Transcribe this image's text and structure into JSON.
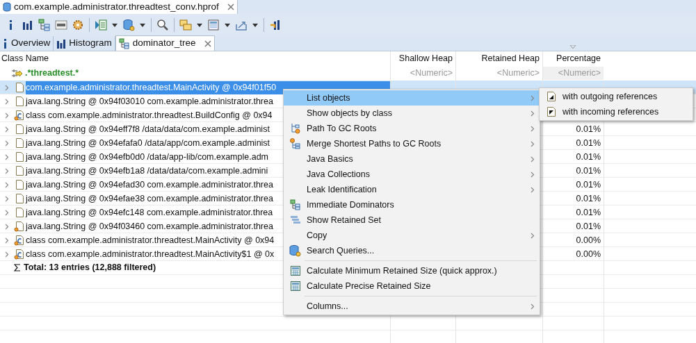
{
  "editor_tab": {
    "title": "com.example.administrator.threadtest_conv.hprof"
  },
  "tabs": [
    {
      "label": "Overview",
      "kind": "info",
      "selected": false
    },
    {
      "label": "Histogram",
      "kind": "bars",
      "selected": false
    },
    {
      "label": "dominator_tree",
      "kind": "tree",
      "selected": true
    }
  ],
  "table": {
    "columns": [
      "Class Name",
      "Shallow Heap",
      "Retained Heap",
      "Percentage"
    ],
    "filter": {
      "name": ".*threadtest.*",
      "shallow": "<Numeric>",
      "retained": "<Numeric>",
      "percentage": "<Numeric>"
    },
    "rows": [
      {
        "name": "com.example.administrator.threadtest.MainActivity @ 0x94f01f50",
        "kind": "object",
        "gc_root": false,
        "selected": true
      },
      {
        "name": "java.lang.String @ 0x94f03010  com.example.administrator.threa",
        "kind": "object",
        "gc_root": false,
        "selected": false
      },
      {
        "name": "class com.example.administrator.threadtest.BuildConfig @ 0x94",
        "kind": "class",
        "gc_root": true,
        "selected": false
      },
      {
        "name": "java.lang.String @ 0x94eff7f8  /data/data/com.example.administ",
        "kind": "object",
        "gc_root": false,
        "selected": false,
        "percentage": "0.01%"
      },
      {
        "name": "java.lang.String @ 0x94efafa0  /data/app/com.example.administ",
        "kind": "object",
        "gc_root": false,
        "selected": false,
        "percentage": "0.01%"
      },
      {
        "name": "java.lang.String @ 0x94efb0d0  /data/app-lib/com.example.adm",
        "kind": "object",
        "gc_root": false,
        "selected": false,
        "percentage": "0.01%"
      },
      {
        "name": "java.lang.String @ 0x94efb1a8  /data/data/com.example.admini",
        "kind": "object",
        "gc_root": false,
        "selected": false,
        "percentage": "0.01%"
      },
      {
        "name": "java.lang.String @ 0x94efad30  com.example.administrator.threa",
        "kind": "object",
        "gc_root": false,
        "selected": false,
        "percentage": "0.01%"
      },
      {
        "name": "java.lang.String @ 0x94efae38  com.example.administrator.threa",
        "kind": "object",
        "gc_root": false,
        "selected": false,
        "percentage": "0.01%"
      },
      {
        "name": "java.lang.String @ 0x94efc148  com.example.administrator.threa",
        "kind": "object",
        "gc_root": false,
        "selected": false,
        "percentage": "0.01%"
      },
      {
        "name": "java.lang.String @ 0x94f03460  com.example.administrator.threa",
        "kind": "object",
        "gc_root": true,
        "selected": false,
        "percentage": "0.01%"
      },
      {
        "name": "class com.example.administrator.threadtest.MainActivity @ 0x94",
        "kind": "class",
        "gc_root": true,
        "selected": false,
        "percentage": "0.00%"
      },
      {
        "name": "class com.example.administrator.threadtest.MainActivity$1 @ 0x",
        "kind": "class",
        "gc_root": true,
        "selected": false,
        "percentage": "0.00%"
      }
    ],
    "total": "Total: 13 entries (12,888 filtered)"
  },
  "context_menu": [
    {
      "kind": "item",
      "label": "List objects",
      "submenu": true,
      "selected": true
    },
    {
      "kind": "item",
      "label": "Show objects by class",
      "submenu": true,
      "selected": false
    },
    {
      "kind": "item",
      "label": "Path To GC Roots",
      "submenu": true,
      "selected": false
    },
    {
      "kind": "item",
      "label": "Merge Shortest Paths to GC Roots",
      "submenu": true,
      "selected": false
    },
    {
      "kind": "item",
      "label": "Java Basics",
      "submenu": true,
      "selected": false
    },
    {
      "kind": "item",
      "label": "Java Collections",
      "submenu": true,
      "selected": false
    },
    {
      "kind": "item",
      "label": "Leak Identification",
      "submenu": true,
      "selected": false
    },
    {
      "kind": "item",
      "label": "Immediate Dominators",
      "submenu": false,
      "selected": false
    },
    {
      "kind": "item",
      "label": "Show Retained Set",
      "submenu": false,
      "selected": false
    },
    {
      "kind": "item",
      "label": "Copy",
      "submenu": true,
      "selected": false
    },
    {
      "kind": "item",
      "label": "Search Queries...",
      "submenu": false,
      "selected": false
    },
    {
      "kind": "separator"
    },
    {
      "kind": "item",
      "label": "Calculate Minimum Retained Size (quick approx.)",
      "submenu": false,
      "selected": false
    },
    {
      "kind": "item",
      "label": "Calculate Precise Retained Size",
      "submenu": false,
      "selected": false
    },
    {
      "kind": "separator"
    },
    {
      "kind": "item",
      "label": "Columns...",
      "submenu": true,
      "selected": false
    }
  ],
  "submenu": [
    {
      "label": "with outgoing references"
    },
    {
      "label": "with incoming references"
    }
  ]
}
